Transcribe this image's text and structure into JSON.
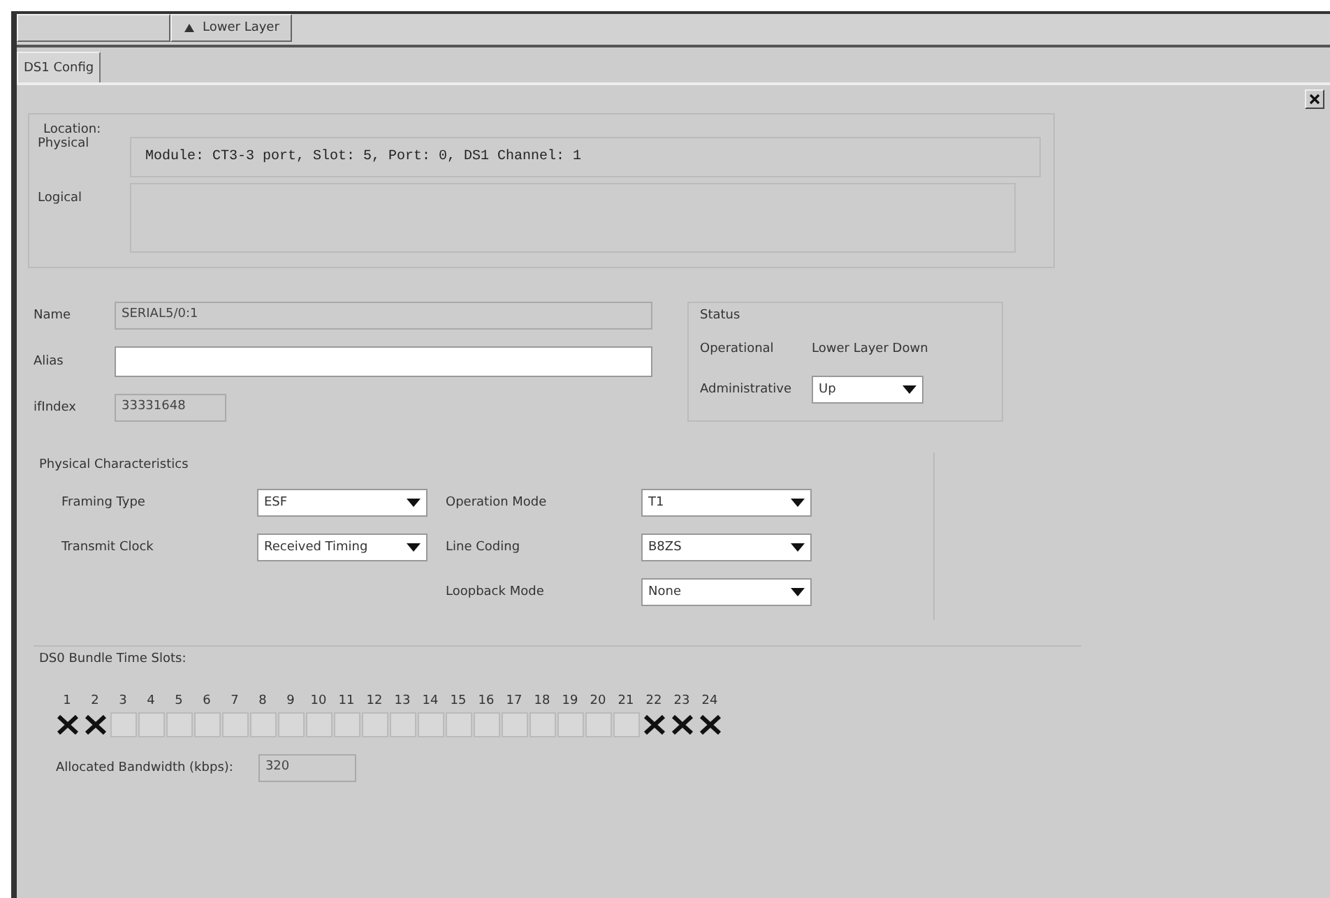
{
  "toolbar": [
    {
      "kind": "plain",
      "disabled": true
    },
    {
      "kind": "arrow",
      "label": "Lower Layer",
      "disabled": false
    }
  ],
  "tabs": [
    {
      "label": "DS1 Config",
      "selected": true
    }
  ],
  "location": {
    "title": "Location:",
    "physical_label": "Physical",
    "physical": "Module: CT3-3 port, Slot: 5, Port: 0, DS1 Channel: 1",
    "logical_label": "Logical"
  },
  "identity": {
    "name_label": "Name",
    "name": "SERIAL5/0:1",
    "alias_label": "Alias",
    "ifindex_label": "ifIndex",
    "ifindex": "33331648"
  },
  "status": {
    "title": "Status",
    "operational_label": "Operational",
    "operational": "Lower Layer Down",
    "administrative_label": "Administrative",
    "administrative": "Up"
  },
  "physical": {
    "title": "Physical Characteristics",
    "fields": [
      {
        "label": "Framing Type",
        "value": "ESF"
      },
      {
        "label": "Operation Mode",
        "value": "T1"
      },
      {
        "label": "Transmit Clock",
        "value": "Received Timing"
      },
      {
        "label": "Line Coding",
        "value": "B8ZS"
      },
      {
        "label": "Loopback Mode",
        "value": "None"
      }
    ]
  },
  "time_slots": {
    "title": "DS0 Bundle Time Slots:",
    "slots": [
      {
        "label": "1",
        "checked": true
      },
      {
        "label": "2",
        "checked": true
      },
      {
        "label": "3",
        "checked": false
      },
      {
        "label": "4",
        "checked": false
      },
      {
        "label": "5",
        "checked": false
      },
      {
        "label": "6",
        "checked": false
      },
      {
        "label": "7",
        "checked": false
      },
      {
        "label": "8",
        "checked": false
      },
      {
        "label": "9",
        "checked": false
      },
      {
        "label": "10",
        "checked": false
      },
      {
        "label": "11",
        "checked": false
      },
      {
        "label": "12",
        "checked": false
      },
      {
        "label": "13",
        "checked": false
      },
      {
        "label": "14",
        "checked": false
      },
      {
        "label": "15",
        "checked": false
      },
      {
        "label": "16",
        "checked": false
      },
      {
        "label": "17",
        "checked": false
      },
      {
        "label": "18",
        "checked": false
      },
      {
        "label": "19",
        "checked": false
      },
      {
        "label": "20",
        "checked": false
      },
      {
        "label": "21",
        "checked": false
      },
      {
        "label": "22",
        "checked": true
      },
      {
        "label": "23",
        "checked": true
      },
      {
        "label": "24",
        "checked": true
      }
    ],
    "bandwidth_label": "Allocated Bandwidth (kbps):",
    "bandwidth": "320"
  }
}
